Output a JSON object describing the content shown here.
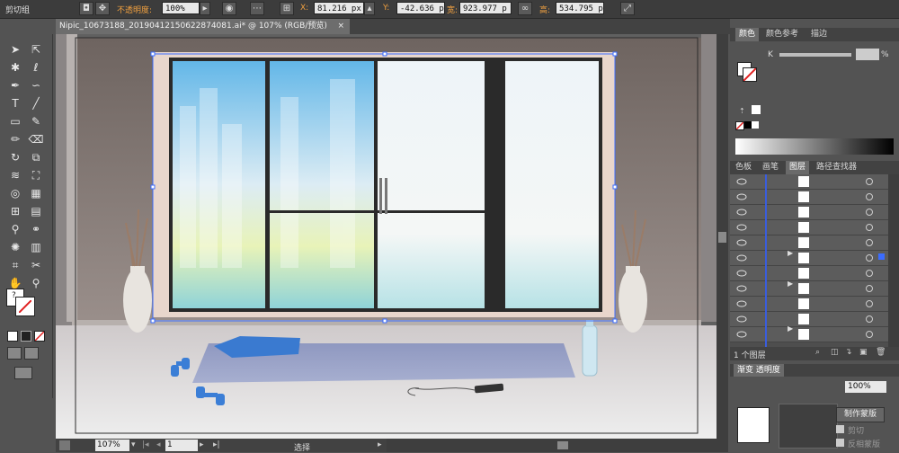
{
  "control_bar": {
    "selection_type": "剪切组",
    "opacity_label": "不透明度:",
    "opacity_value": "100%",
    "x_label": "X:",
    "x_value": "81.216 px",
    "y_label": "Y:",
    "y_value": "-42.636 p",
    "w_label": "宽:",
    "w_value": "923.977 p",
    "h_label": "高:",
    "h_value": "534.795 p"
  },
  "document": {
    "tab_title": "Nipic_10673188_20190412150622874081.ai* @ 107% (RGB/预览)",
    "close_glyph": "×"
  },
  "status_bar": {
    "zoom": "107%",
    "artboard": "1",
    "tool_label": "选择"
  },
  "color_panel": {
    "tabs": [
      "颜色",
      "颜色参考",
      "描边"
    ],
    "k_label": "K",
    "k_value": "%"
  },
  "layers_panel": {
    "tabs": [
      "色板",
      "画笔",
      "图层",
      "路径查找器"
    ],
    "footer": "1 个图层",
    "row_glyph": "<..."
  },
  "transparency_panel": {
    "tab": "渐变  透明度",
    "opacity": "100%",
    "make_mask_button": "制作蒙版",
    "clip_label": "剪切",
    "invert_label": "反相蒙版"
  },
  "colors": {
    "ui_dark": "#3c3c3c",
    "ui_mid": "#535353",
    "accent_orange": "#f0a040",
    "layer_line_blue": "#3a5ddc",
    "selection_blue": "#3b6cff"
  }
}
